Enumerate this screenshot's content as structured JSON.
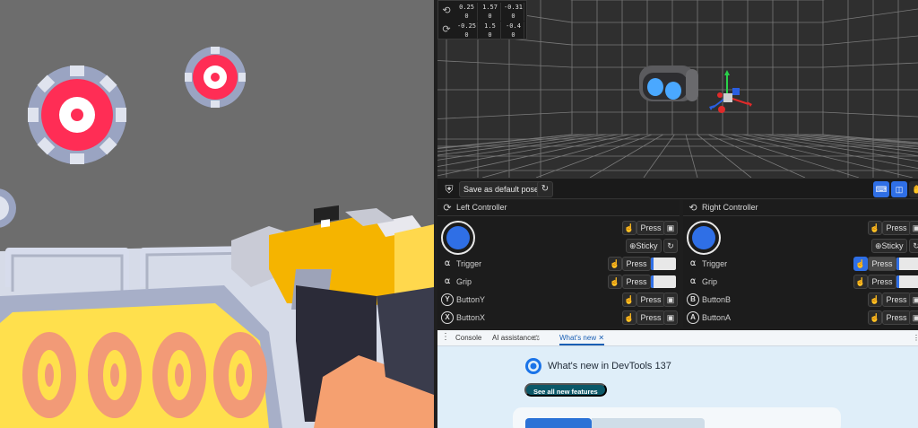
{
  "pose_readout": {
    "headset_row": {
      "icon": "headset-icon",
      "values": [
        "0.25",
        "1.57",
        "-0.31",
        "0",
        "0",
        "0"
      ]
    },
    "controller_row": {
      "icon": "controller-icon",
      "values": [
        "-0.25",
        "1.5",
        "-0.4",
        "0",
        "0",
        "0"
      ]
    }
  },
  "toolbar": {
    "save_label": "Save as default pose",
    "reset_icon": "reset-icon",
    "figure_icon": "user-pose-icon",
    "modes": [
      "keyboard-icon",
      "vr-headset-icon",
      "hand-icon"
    ]
  },
  "left_controller": {
    "title": "Left Controller",
    "press_label": "Press",
    "sticky_label": "Sticky",
    "rows": [
      {
        "label": "Trigger",
        "value": 0.0
      },
      {
        "label": "Grip",
        "value": 0.0
      },
      {
        "label": "ButtonY",
        "badge": "Y"
      },
      {
        "label": "ButtonX",
        "badge": "X"
      }
    ]
  },
  "right_controller": {
    "title": "Right Controller",
    "press_label": "Press",
    "sticky_label": "Sticky",
    "rows": [
      {
        "label": "Trigger",
        "value": 0.0,
        "pressed": true
      },
      {
        "label": "Grip",
        "value": 0.0
      },
      {
        "label": "ButtonB",
        "badge": "B"
      },
      {
        "label": "ButtonA",
        "badge": "A"
      }
    ]
  },
  "devtools": {
    "tabs": [
      "Console",
      "AI assistance",
      "What's new"
    ],
    "active_tab": "What's new",
    "whats_new_title": "What's new in DevTools 137",
    "see_all_label": "See all new features"
  },
  "scene": {
    "score_digits": [
      "0",
      "0",
      "0",
      "0"
    ]
  },
  "colors": {
    "accent": "#2f6fe6",
    "target_red": "#ff2d55",
    "gun_yellow": "#f5b400",
    "score_panel": "#ffe04d",
    "score_digit": "#f29a77"
  }
}
